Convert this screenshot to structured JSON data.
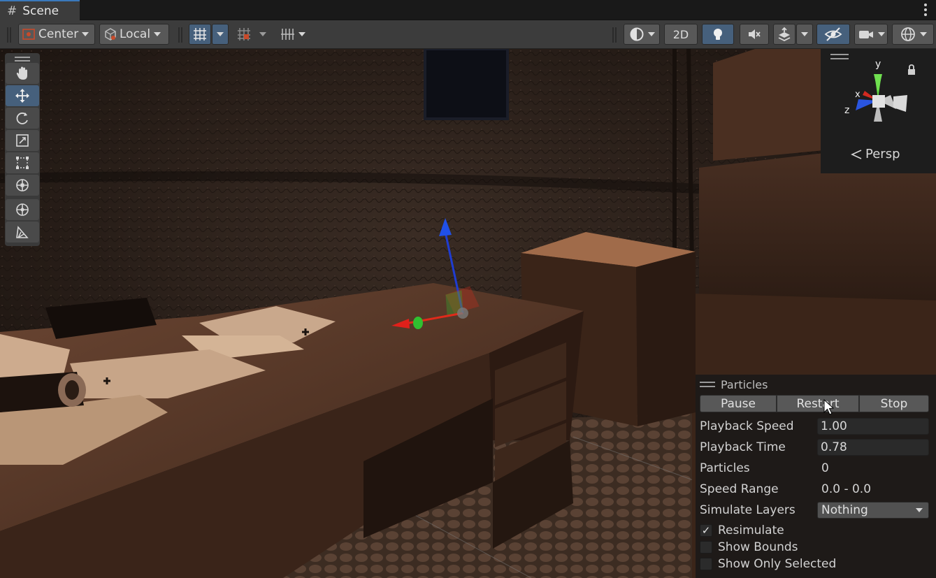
{
  "tab": {
    "title": "Scene"
  },
  "toolbar": {
    "pivot_label": "Center",
    "space_label": "Local",
    "two_d_label": "2D"
  },
  "gizmo": {
    "axis_y": "y",
    "axis_x": "x",
    "axis_z": "z",
    "projection_label": "Persp"
  },
  "particles": {
    "title": "Particles",
    "pause_label": "Pause",
    "restart_label": "Restart",
    "stop_label": "Stop",
    "playback_speed_label": "Playback Speed",
    "playback_speed_value": "1.00",
    "playback_time_label": "Playback Time",
    "playback_time_value": "0.78",
    "particles_label": "Particles",
    "particles_value": "0",
    "speed_range_label": "Speed Range",
    "speed_range_value": "0.0 - 0.0",
    "simulate_layers_label": "Simulate Layers",
    "simulate_layers_value": "Nothing",
    "resimulate_label": "Resimulate",
    "resimulate_checked": true,
    "show_bounds_label": "Show Bounds",
    "show_bounds_checked": false,
    "show_only_selected_label": "Show Only Selected",
    "show_only_selected_checked": false
  },
  "colors": {
    "accent": "#3a79bb",
    "active_button": "#46607c",
    "axis_x": "#e02020",
    "axis_y": "#30c030",
    "axis_z": "#2050e0"
  }
}
